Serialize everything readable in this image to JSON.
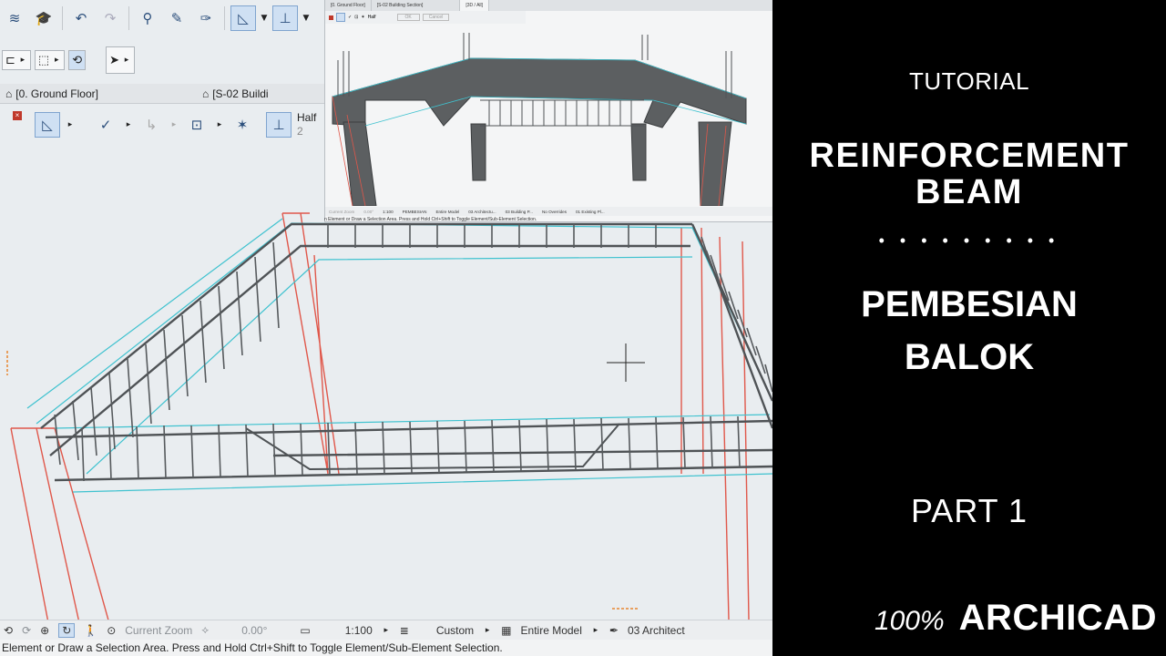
{
  "plan_tab": {
    "floor_label": "[0. Ground Floor]",
    "section_label": "[S-02 Buildi"
  },
  "info_box": {
    "line_type": "Half",
    "line_num": "2"
  },
  "mini_window": {
    "tabs": [
      "[0. Ground Floor]",
      "[S-02 Building Section]",
      "[3D / All]"
    ],
    "status": [
      "Current Zoom",
      "0.00°",
      "1:100",
      "PEMBESIAN",
      "Entire Model",
      "03 Architectu...",
      "03 Building P...",
      "No Overrides",
      "01 Existing Pl..."
    ],
    "hint": "n Element or Draw a Selection Area. Press and Hold Ctrl+Shift to Toggle Element/Sub-Element Selection.",
    "btns": [
      "OK",
      "Cancel"
    ]
  },
  "statusbar": {
    "zoom": "Current Zoom",
    "angle": "0.00°",
    "scale": "1:100",
    "layer": "Custom",
    "model": "Entire Model",
    "pen": "03 Architect"
  },
  "hint_text": "Element or Draw a Selection Area. Press and Hold Ctrl+Shift to Toggle Element/Sub-Element Selection.",
  "panel": {
    "tutorial": "TUTORIAL",
    "title_line1": "REINFORCEMENT",
    "title_line2": "BEAM",
    "dots": "• • • • • • • • •",
    "sub_line1": "PEMBESIAN",
    "sub_line2": "BALOK",
    "part": "PART 1",
    "percent": "100%",
    "brand": "ARCHICAD"
  },
  "colors": {
    "panel_bg": "#000000",
    "edge_red": "#e0574a",
    "edge_cyan": "#3fc2cf",
    "rebar": "#4f5356",
    "concrete": "#5c5f61"
  }
}
